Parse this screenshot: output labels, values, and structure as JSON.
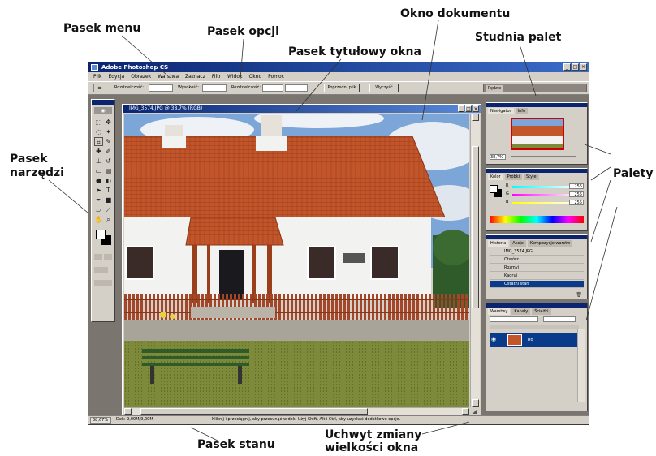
{
  "callouts": {
    "menu_bar": "Pasek menu",
    "options_bar": "Pasek opcji",
    "window_title_bar": "Pasek tytułowy okna",
    "document_window": "Okno dokumentu",
    "palette_well": "Studnia palet",
    "toolbox_line1": "Pasek",
    "toolbox_line2": "narzędzi",
    "palettes": "Palety",
    "status_bar": "Pasek stanu",
    "resize_handle_line1": "Uchwyt zmiany",
    "resize_handle_line2": "wielkości okna"
  },
  "app": {
    "title": "Adobe Photoshop CS",
    "menu": [
      "Plik",
      "Edycja",
      "Obrazek",
      "Warstwa",
      "Zaznacz",
      "Filtr",
      "Widok",
      "Okno",
      "Pomoc"
    ],
    "options": {
      "fields": [
        "Rozdzielczość:",
        "Wysokość:",
        "Rozdzielczość:"
      ],
      "buttons": [
        "Poprzedni plik",
        "Wyczyść"
      ]
    },
    "palette_well_tab": "Pędzle"
  },
  "document": {
    "title": "IMG_3574.JPG @ 38,7% (RGB)"
  },
  "palettes": {
    "navigator": {
      "tabs": [
        "Nawigator",
        "Info"
      ],
      "zoom": "38,7%"
    },
    "color": {
      "tabs": [
        "Kolor",
        "Próbki",
        "Style"
      ],
      "channels": [
        "R",
        "G",
        "B"
      ],
      "values": [
        "255",
        "255",
        "255"
      ]
    },
    "history": {
      "tabs": [
        "Historia",
        "Akcje",
        "Kompozycje warstw"
      ],
      "items": [
        "IMG_3574.JPG",
        "Otwórz",
        "Rozmyj",
        "Kadruj",
        "Ostatni stan"
      ]
    },
    "layers": {
      "tabs": [
        "Warstwy",
        "Kanały",
        "Ścieżki"
      ],
      "layer": "Tło"
    }
  },
  "status": {
    "zoom": "38,67%",
    "doc": "Dok: 9,00M/9,00M",
    "hint": "Kliknij i przeciągnij, aby przesunąć widok. Użyj Shift, Alt i Ctrl, aby uzyskać dodatkowe opcje."
  },
  "colors": {
    "title_bar": "#0a2470",
    "ui_face": "#d4d0c8",
    "workspace": "#7a756f",
    "roof": "#c2562a",
    "wall": "#f2f2f0",
    "sky": "#7da6d8",
    "grass": "#7c8a3a"
  },
  "icons": [
    "move-icon",
    "marquee-icon",
    "lasso-icon",
    "magic-wand-icon",
    "crop-icon",
    "brush-icon",
    "stamp-icon",
    "eraser-icon",
    "gradient-icon",
    "text-icon",
    "pen-icon",
    "hand-icon",
    "zoom-icon",
    "eye-icon"
  ]
}
